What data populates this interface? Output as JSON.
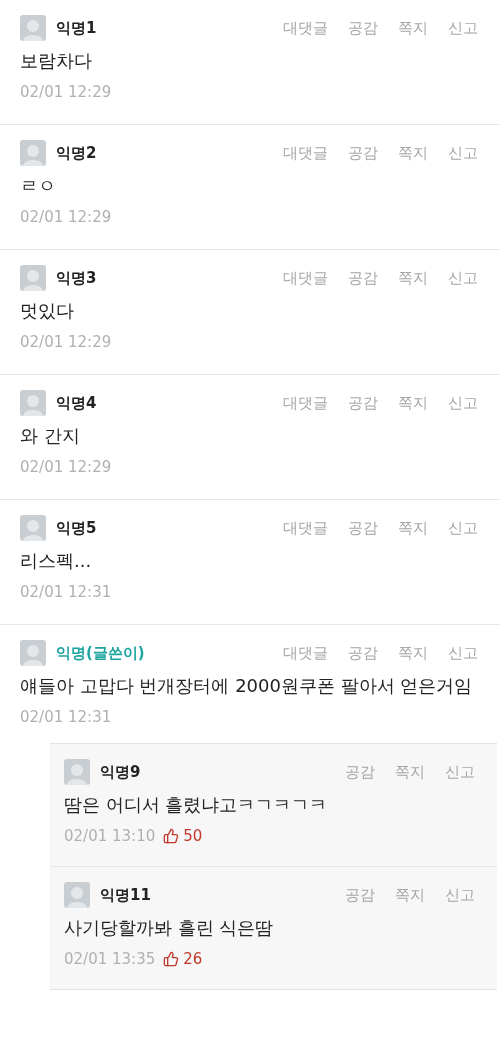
{
  "comments": [
    {
      "author": "익명1",
      "kind": "normal",
      "actions": [
        "대댓글",
        "공감",
        "쪽지",
        "신고"
      ],
      "body": "보람차다",
      "date": "02/01 12:29"
    },
    {
      "author": "익명2",
      "kind": "normal",
      "actions": [
        "대댓글",
        "공감",
        "쪽지",
        "신고"
      ],
      "body": "ㄹㅇ",
      "date": "02/01 12:29"
    },
    {
      "author": "익명3",
      "kind": "normal",
      "actions": [
        "대댓글",
        "공감",
        "쪽지",
        "신고"
      ],
      "body": "멋있다",
      "date": "02/01 12:29"
    },
    {
      "author": "익명4",
      "kind": "normal",
      "actions": [
        "대댓글",
        "공감",
        "쪽지",
        "신고"
      ],
      "body": "와 간지",
      "date": "02/01 12:29"
    },
    {
      "author": "익명5",
      "kind": "normal",
      "actions": [
        "대댓글",
        "공감",
        "쪽지",
        "신고"
      ],
      "body": "리스펙...",
      "date": "02/01 12:31"
    },
    {
      "author": "익명(글쓴이)",
      "kind": "author",
      "actions": [
        "대댓글",
        "공감",
        "쪽지",
        "신고"
      ],
      "body": "얘들아 고맙다 번개장터에 2000원쿠폰 팔아서 얻은거임",
      "date": "02/01 12:31",
      "replies": [
        {
          "author": "익명9",
          "kind": "normal",
          "actions": [
            "공감",
            "쪽지",
            "신고"
          ],
          "body": "땀은 어디서 흘렸냐고ㅋㄱㅋㄱㅋ",
          "date": "02/01 13:10",
          "likes": "50"
        },
        {
          "author": "익명11",
          "kind": "normal",
          "actions": [
            "공감",
            "쪽지",
            "신고"
          ],
          "body": "사기당할까봐 흘린 식은땀",
          "date": "02/01 13:35",
          "likes": "26"
        }
      ]
    }
  ]
}
